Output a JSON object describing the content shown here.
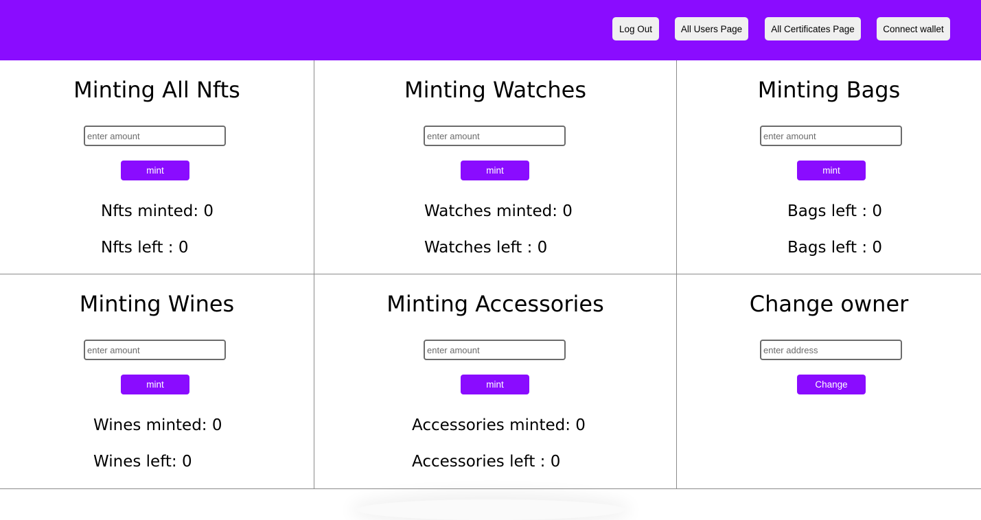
{
  "header": {
    "bg_color": "#8a0cff",
    "buttons": {
      "logout": "Log Out",
      "all_users": "All Users Page",
      "all_certificates": "All Certificates Page",
      "connect_wallet": "Connect wallet"
    }
  },
  "accent_color": "#8a0cff",
  "panels": {
    "all_nfts": {
      "title": "Minting All Nfts",
      "placeholder": "enter amount",
      "button": "mint",
      "stat1": "Nfts minted: 0",
      "stat2": "Nfts left : 0"
    },
    "watches": {
      "title": "Minting Watches",
      "placeholder": "enter amount",
      "button": "mint",
      "stat1": "Watches minted: 0",
      "stat2": "Watches left : 0"
    },
    "bags": {
      "title": "Minting Bags",
      "placeholder": "enter amount",
      "button": "mint",
      "stat1": "Bags left : 0",
      "stat2": "Bags left : 0"
    },
    "wines": {
      "title": "Minting Wines",
      "placeholder": "enter amount",
      "button": "mint",
      "stat1": "Wines minted: 0",
      "stat2": "Wines left: 0"
    },
    "accessories": {
      "title": "Minting Accessories",
      "placeholder": "enter amount",
      "button": "mint",
      "stat1": "Accessories minted: 0",
      "stat2": "Accessories left : 0"
    },
    "change_owner": {
      "title": "Change owner",
      "placeholder": "enter address",
      "button": "Change"
    }
  }
}
